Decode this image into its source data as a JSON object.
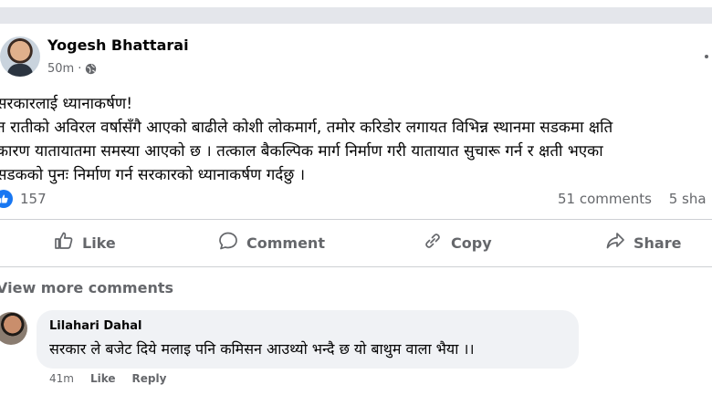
{
  "post": {
    "author": "Yogesh Bhattarai",
    "time": "50m",
    "time_separator": "·",
    "lines": [
      "सरकारलाई ध्यानाकर्षण!",
      "त रातीको अविरल वर्षासँगै आएको बाढीले कोशी लोकमार्ग, तमोर करिडोर लगायत विभिन्न स्थानमा सडकमा क्षति",
      "कारण यातायातमा समस्या आएको छ । तत्काल बैकल्पिक मार्ग निर्माण गरी यातायात सुचारू गर्न र क्षती भएका",
      "सडकको पुनः निर्माण गर्न सरकारको ध्यानाकर्षण गर्दछु ।"
    ],
    "reactions_count": "157",
    "comments_count": "51 comments",
    "shares_count": "5 sha"
  },
  "actions": {
    "like": "Like",
    "comment": "Comment",
    "copy": "Copy",
    "share": "Share"
  },
  "view_more_comments": "View more comments",
  "comment": {
    "author": "Lilahari Dahal",
    "text": "सरकार ले बजेट दिये मलाइ पनि कमिसन आउथ्यो भन्दै छ यो बाथुम वाला भैया ।।",
    "time": "41m",
    "like": "Like",
    "reply": "Reply"
  },
  "colors": {
    "accent": "#1877f2",
    "secondary_text": "#65676b",
    "bubble": "#f0f2f5"
  }
}
